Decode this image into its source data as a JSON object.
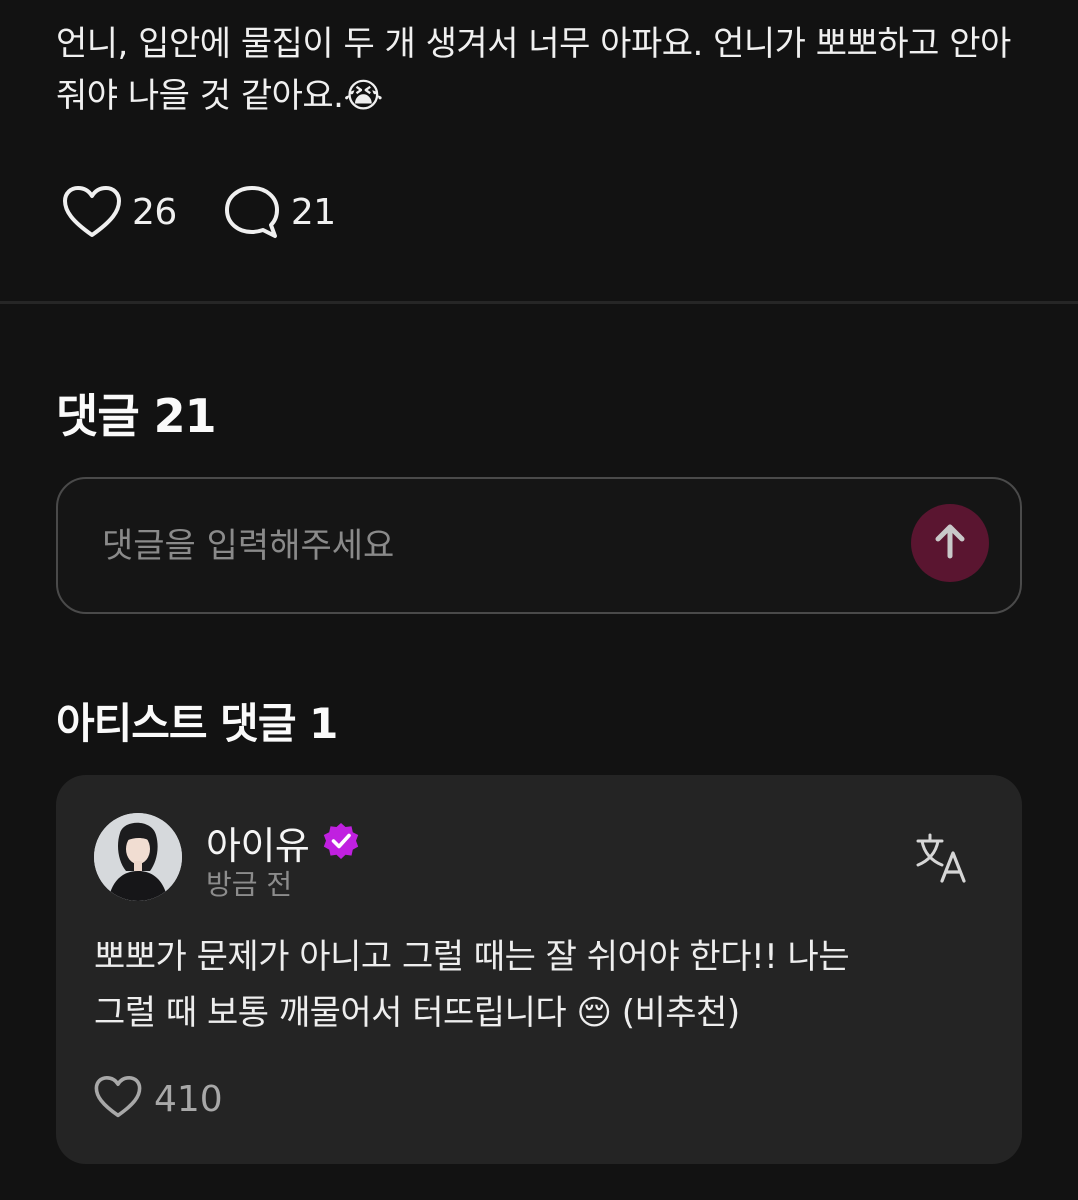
{
  "post": {
    "text": "언니, 입안에 물집이 두 개 생겨서 너무 아파요. 언니가 뽀뽀하고 안아줘야 나을 것 같아요.",
    "emoji": "😭",
    "like_count": "26",
    "comment_count": "21",
    "like_icon": "heart-outline-icon",
    "comment_icon": "speech-bubble-icon"
  },
  "comments": {
    "title": "댓글 21",
    "input_placeholder": "댓글을 입력해주세요",
    "input_value": "",
    "send_icon": "arrow-up-icon"
  },
  "artist_comments": {
    "title": "아티스트 댓글 1",
    "items": [
      {
        "author": "아이유",
        "verified_icon": "verified-badge-icon",
        "time": "방금 전",
        "translate_icon": "translate-icon",
        "text_line1": "뽀뽀가 문제가 아니고 그럴 때는 잘 쉬어야 한다!! 나는",
        "text_line2_start": "그럴 때 보통 깨물어서 터뜨립니다",
        "text_emoji": "😔",
        "text_line2_end": "(비추천)",
        "like_count": "410"
      }
    ]
  },
  "colors": {
    "background": "#121212",
    "card": "#242424",
    "accent_button": "#5a1530",
    "verified": "#c020e0"
  }
}
